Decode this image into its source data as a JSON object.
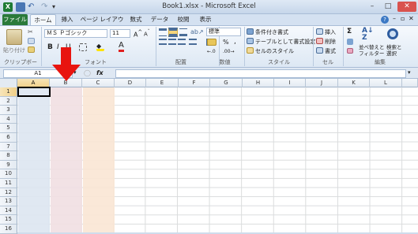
{
  "window": {
    "title": "Book1.xlsx - Microsoft Excel",
    "controls": {
      "minimize": "–",
      "maximize": "□",
      "close": "✕"
    }
  },
  "tabs": [
    "ファイル",
    "ホーム",
    "挿入",
    "ページ レイアウト",
    "数式",
    "データ",
    "校閲",
    "表示"
  ],
  "ribbon": {
    "clipboard": {
      "paste": "貼り付け",
      "label": "クリップボード"
    },
    "font": {
      "name": "ＭＳ Ｐゴシック",
      "size": "11",
      "bold": "B",
      "italic": "I",
      "underline": "U",
      "label": "フォント"
    },
    "alignment": {
      "label": "配置"
    },
    "number": {
      "format": "標準",
      "percent": "%",
      "comma": ",",
      "label": "数値"
    },
    "styles": {
      "conditional": "条件付き書式",
      "table": "テーブルとして書式設定",
      "cell_styles": "セルのスタイル",
      "label": "スタイル"
    },
    "cells": {
      "insert": "挿入",
      "delete": "削除",
      "format": "書式",
      "label": "セル"
    },
    "editing": {
      "sum": "Σ",
      "sort": "並べ替えと",
      "sort2": "フィルター",
      "find": "検索と",
      "find2": "選択",
      "label": "編集"
    }
  },
  "formula_bar": {
    "name_box": "A1",
    "fx": "fx",
    "content": ""
  },
  "columns": [
    "A",
    "B",
    "C",
    "D",
    "E",
    "F",
    "G",
    "H",
    "I",
    "J",
    "K",
    "L"
  ],
  "rows": [
    "1",
    "2",
    "3",
    "4",
    "5",
    "6",
    "7",
    "8",
    "9",
    "10",
    "11",
    "12",
    "13",
    "14",
    "15",
    "16"
  ],
  "colors": {
    "col_a_fill": "#dde6f1",
    "col_b_fill": "#f1dfe2",
    "col_c_fill": "#f9e6d4",
    "arrow": "#e8140f",
    "accent": "#2a7a3a"
  }
}
